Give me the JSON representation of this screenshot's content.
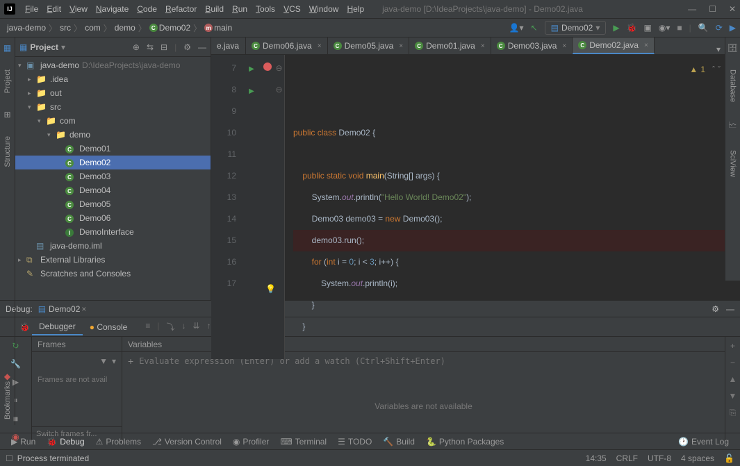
{
  "title": "java-demo [D:\\IdeaProjects\\java-demo] - Demo02.java",
  "menu": [
    "File",
    "Edit",
    "View",
    "Navigate",
    "Code",
    "Refactor",
    "Build",
    "Run",
    "Tools",
    "VCS",
    "Window",
    "Help"
  ],
  "breadcrumbs": [
    "java-demo",
    "src",
    "com",
    "demo",
    "Demo02",
    "main"
  ],
  "runConfig": "Demo02",
  "projectPanel": {
    "title": "Project",
    "root": {
      "name": "java-demo",
      "path": "D:\\IdeaProjects\\java-demo"
    },
    "idea": ".idea",
    "out": "out",
    "src": "src",
    "com": "com",
    "demo": "demo",
    "classes": [
      "Demo01",
      "Demo02",
      "Demo03",
      "Demo04",
      "Demo05",
      "Demo06"
    ],
    "iface": "DemoInterface",
    "iml": "java-demo.iml",
    "ext": "External Libraries",
    "scratch": "Scratches and Consoles"
  },
  "tabs": [
    "e.java",
    "Demo06.java",
    "Demo05.java",
    "Demo01.java",
    "Demo03.java",
    "Demo02.java"
  ],
  "activeTab": 5,
  "warnings": "1",
  "code": {
    "lines": [
      {
        "n": 7,
        "tokens": [
          {
            "t": "public ",
            "c": "kw"
          },
          {
            "t": "class ",
            "c": "kw"
          },
          {
            "t": "Demo02 ",
            "c": "cname"
          },
          {
            "t": "{",
            "c": "typ"
          }
        ],
        "run": true
      },
      {
        "n": 8,
        "tokens": []
      },
      {
        "n": 9,
        "tokens": [
          {
            "t": "    public ",
            "c": "kw"
          },
          {
            "t": "static ",
            "c": "kw"
          },
          {
            "t": "void ",
            "c": "kw"
          },
          {
            "t": "main",
            "c": "mth"
          },
          {
            "t": "(",
            "c": "typ"
          },
          {
            "t": "String",
            "c": "typ"
          },
          {
            "t": "[] ",
            "c": "typ"
          },
          {
            "t": "args",
            "c": "typ"
          },
          {
            "t": ") {",
            "c": "typ"
          }
        ],
        "run": true,
        "fold": "⊖"
      },
      {
        "n": 10,
        "tokens": [
          {
            "t": "        System.",
            "c": "typ"
          },
          {
            "t": "out",
            "c": "fld"
          },
          {
            "t": ".println(",
            "c": "typ"
          },
          {
            "t": "\"Hello World! Demo02\"",
            "c": "str"
          },
          {
            "t": ");",
            "c": "typ"
          }
        ]
      },
      {
        "n": 11,
        "tokens": [
          {
            "t": "        Demo03 ",
            "c": "typ"
          },
          {
            "t": "demo03 ",
            "c": "typ"
          },
          {
            "t": "= ",
            "c": "typ"
          },
          {
            "t": "new ",
            "c": "kw"
          },
          {
            "t": "Demo03();",
            "c": "typ"
          }
        ]
      },
      {
        "n": 12,
        "tokens": [
          {
            "t": "        demo03.run();",
            "c": "typ"
          }
        ],
        "bp": true,
        "hl": true
      },
      {
        "n": 13,
        "tokens": [
          {
            "t": "        for ",
            "c": "kw"
          },
          {
            "t": "(",
            "c": "typ"
          },
          {
            "t": "int ",
            "c": "kw"
          },
          {
            "t": "i ",
            "c": "typ"
          },
          {
            "t": "= ",
            "c": "typ"
          },
          {
            "t": "0",
            "c": "num"
          },
          {
            "t": "; ",
            "c": "typ"
          },
          {
            "t": "i ",
            "c": "typ"
          },
          {
            "t": "< ",
            "c": "typ"
          },
          {
            "t": "3",
            "c": "num"
          },
          {
            "t": "; ",
            "c": "typ"
          },
          {
            "t": "i",
            "c": "typ"
          },
          {
            "t": "++) {",
            "c": "typ"
          }
        ],
        "fold": "⊖"
      },
      {
        "n": 14,
        "tokens": [
          {
            "t": "            System.",
            "c": "typ"
          },
          {
            "t": "out",
            "c": "fld"
          },
          {
            "t": ".println(",
            "c": "typ"
          },
          {
            "t": "i",
            "c": "typ"
          },
          {
            "t": ");",
            "c": "typ"
          }
        ],
        "bulb": true
      },
      {
        "n": 15,
        "tokens": [
          {
            "t": "        }",
            "c": "typ"
          }
        ]
      },
      {
        "n": 16,
        "tokens": [
          {
            "t": "    }",
            "c": "typ"
          }
        ]
      },
      {
        "n": 17,
        "tokens": []
      }
    ]
  },
  "debug": {
    "title": "Debug:",
    "config": "Demo02",
    "tabs": [
      "Debugger",
      "Console"
    ],
    "framesTitle": "Frames",
    "framesEmpty": "Frames are not avail",
    "framesFoot": "Switch frames fr...",
    "varsTitle": "Variables",
    "varsPlaceholder": "Evaluate expression (Enter) or add a watch (Ctrl+Shift+Enter)",
    "varsEmpty": "Variables are not available"
  },
  "bottomTabs": [
    "Run",
    "Debug",
    "Problems",
    "Version Control",
    "Profiler",
    "Terminal",
    "TODO",
    "Build",
    "Python Packages"
  ],
  "eventLog": "Event Log",
  "status": {
    "msg": "Process terminated",
    "pos": "14:35",
    "eol": "CRLF",
    "enc": "UTF-8",
    "indent": "4 spaces"
  },
  "sideTabs": {
    "project": "Project",
    "structure": "Structure",
    "bookmarks": "Bookmarks",
    "database": "Database",
    "sciview": "SciView"
  }
}
